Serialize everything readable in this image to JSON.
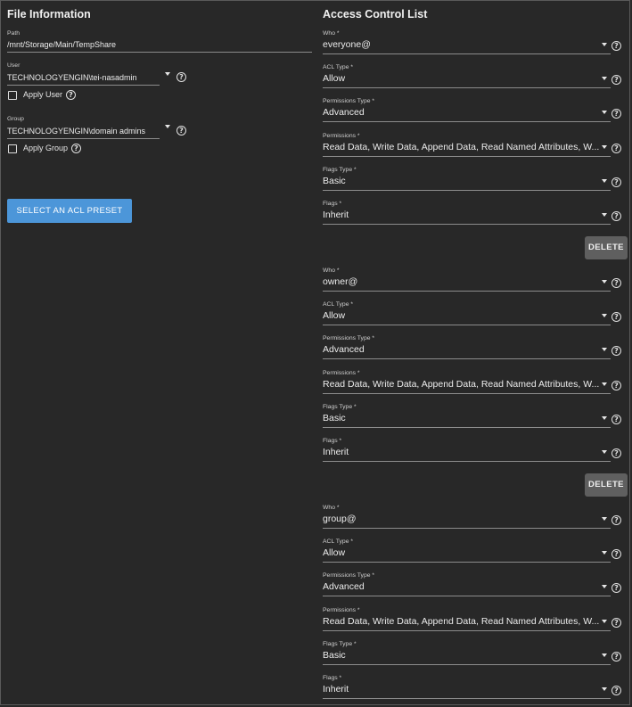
{
  "file_info": {
    "title": "File Information",
    "path": {
      "label": "Path",
      "value": "/mnt/Storage/Main/TempShare"
    },
    "user": {
      "label": "User",
      "value": "TECHNOLOGYENGIN\\tei-nasadmin"
    },
    "apply_user": "Apply User",
    "group": {
      "label": "Group",
      "value": "TECHNOLOGYENGIN\\domain admins"
    },
    "apply_group": "Apply Group",
    "preset_button": "SELECT AN ACL PRESET"
  },
  "acl": {
    "title": "Access Control List",
    "delete_label": "DELETE",
    "field_labels": {
      "who": "Who *",
      "acl_type": "ACL Type *",
      "permissions_type": "Permissions Type *",
      "permissions": "Permissions *",
      "flags_type": "Flags Type *",
      "flags": "Flags *"
    },
    "entries": [
      {
        "who": "everyone@",
        "acl_type": "Allow",
        "permissions_type": "Advanced",
        "permissions": "Read Data, Write Data, Append Data, Read Named Attributes, Write Named Attributes",
        "flags_type": "Basic",
        "flags": "Inherit"
      },
      {
        "who": "owner@",
        "acl_type": "Allow",
        "permissions_type": "Advanced",
        "permissions": "Read Data, Write Data, Append Data, Read Named Attributes, Write Named Attributes",
        "flags_type": "Basic",
        "flags": "Inherit"
      },
      {
        "who": "group@",
        "acl_type": "Allow",
        "permissions_type": "Advanced",
        "permissions": "Read Data, Write Data, Append Data, Read Named Attributes, Write Named Attributes",
        "flags_type": "Basic",
        "flags": "Inherit"
      }
    ]
  }
}
